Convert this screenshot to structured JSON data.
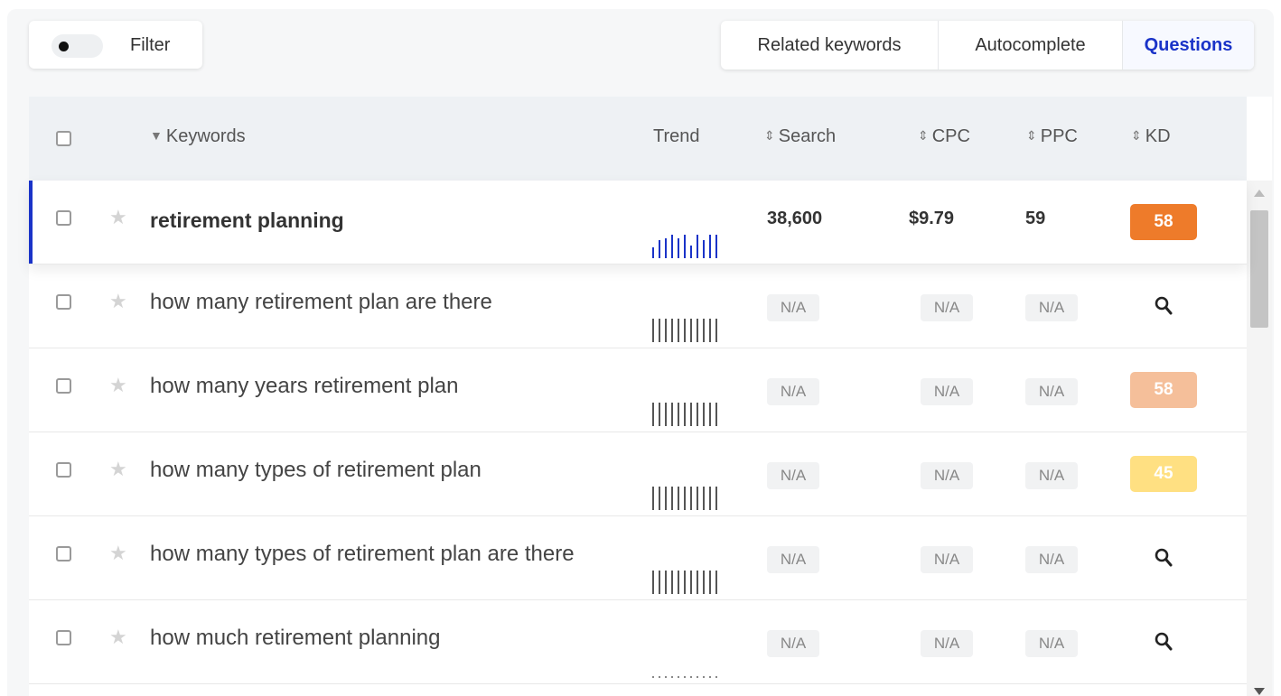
{
  "toolbar": {
    "filter_label": "Filter",
    "filter_toggle_on": false,
    "tabs": [
      {
        "label": "Related keywords",
        "active": false
      },
      {
        "label": "Autocomplete",
        "active": false
      },
      {
        "label": "Questions",
        "active": true
      }
    ]
  },
  "table": {
    "headers": {
      "keywords": "Keywords",
      "trend": "Trend",
      "search": "Search",
      "cpc": "CPC",
      "ppc": "PPC",
      "kd": "KD"
    },
    "rows": [
      {
        "keyword": "retirement planning",
        "search": "38,600",
        "cpc": "$9.79",
        "ppc": "59",
        "kd": "58",
        "kd_color": "#ee7b2a",
        "highlighted": true,
        "trend_color": "#1a33c8",
        "trend": [
          0.45,
          0.75,
          0.85,
          1.0,
          0.85,
          1.0,
          0.55,
          1.0,
          0.75,
          1.0,
          1.0
        ]
      },
      {
        "keyword": "how many retirement plan are there",
        "search": "N/A",
        "cpc": "N/A",
        "ppc": "N/A",
        "kd": "",
        "kd_color": "",
        "highlighted": false,
        "trend_color": "#555555",
        "trend": [
          1,
          1,
          1,
          1,
          1,
          1,
          1,
          1,
          1,
          1,
          1
        ]
      },
      {
        "keyword": "how many years retirement plan",
        "search": "N/A",
        "cpc": "N/A",
        "ppc": "N/A",
        "kd": "58",
        "kd_color": "#f5bf9a",
        "highlighted": false,
        "trend_color": "#555555",
        "trend": [
          1,
          1,
          1,
          1,
          1,
          1,
          1,
          1,
          1,
          1,
          1
        ]
      },
      {
        "keyword": "how many types of retirement plan",
        "search": "N/A",
        "cpc": "N/A",
        "ppc": "N/A",
        "kd": "45",
        "kd_color": "#ffe082",
        "highlighted": false,
        "trend_color": "#555555",
        "trend": [
          1,
          1,
          1,
          1,
          1,
          1,
          1,
          1,
          1,
          1,
          1
        ]
      },
      {
        "keyword": "how many types of retirement plan are there",
        "search": "N/A",
        "cpc": "N/A",
        "ppc": "N/A",
        "kd": "",
        "kd_color": "",
        "highlighted": false,
        "trend_color": "#555555",
        "trend": [
          1,
          1,
          1,
          1,
          1,
          1,
          1,
          1,
          1,
          1,
          1
        ]
      },
      {
        "keyword": "how much retirement planning",
        "search": "N/A",
        "cpc": "N/A",
        "ppc": "N/A",
        "kd": "",
        "kd_color": "",
        "highlighted": false,
        "trend_color": "#555555",
        "trend": [
          0.08,
          0.08,
          0.08,
          0.08,
          0.08,
          0.08,
          0.08,
          0.08,
          0.08,
          0.08,
          0.08
        ]
      }
    ]
  },
  "colors": {
    "accent": "#1a33c8",
    "kd_high": "#ee7b2a",
    "kd_medium": "#f5bf9a",
    "kd_low": "#ffe082"
  },
  "icons": {
    "row_star": "star-icon",
    "kd_empty": "search-icon"
  }
}
